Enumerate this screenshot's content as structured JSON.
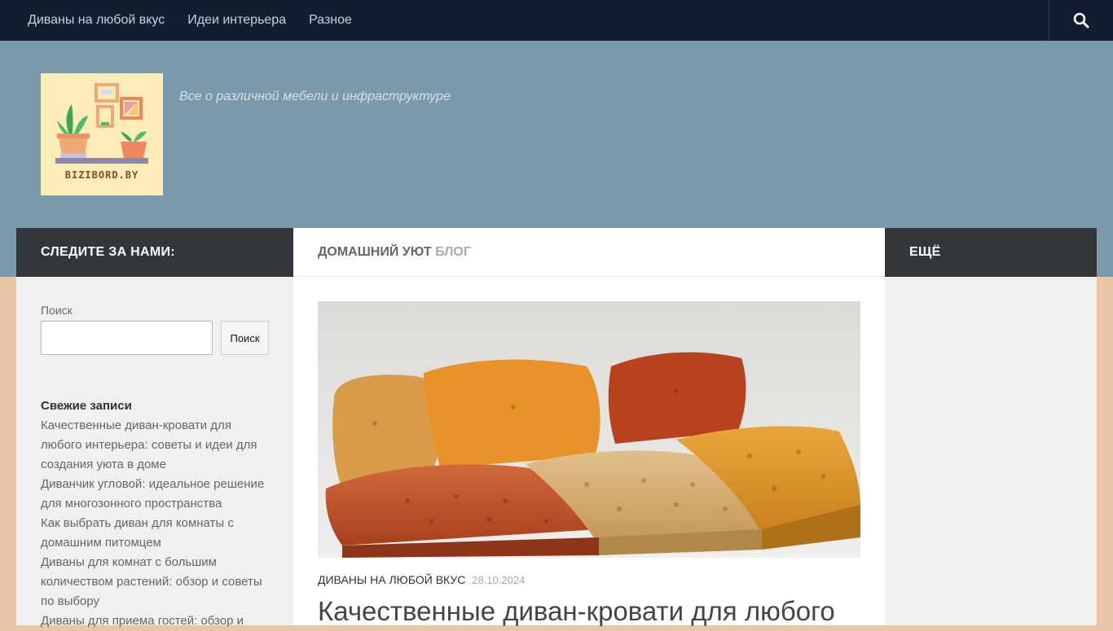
{
  "nav": {
    "items": [
      "Диваны на любой вкус",
      "Идеи интерьера",
      "Разное"
    ],
    "search_icon": "search-icon"
  },
  "header": {
    "logo_text": "BIZIBORD.BY",
    "tagline": "Все о различной мебели и инфраструктуре"
  },
  "left": {
    "heading": "СЛЕДИТЕ ЗА НАМИ:",
    "search_label": "Поиск",
    "search_button": "Поиск",
    "search_value": "",
    "recent_title": "Свежие записи",
    "recent_posts": [
      "Качественные диван-кровати для любого интерьера: советы и идеи для создания уюта в доме",
      "Диванчик угловой: идеальное решение для многозонного пространства",
      "Как выбрать диван для комнаты с домашним питомцем",
      "Диваны для комнат с большим количеством растений: обзор и советы по выбору",
      "Диваны для приема гостей: обзор и"
    ]
  },
  "main": {
    "heading_a": "ДОМАШНИЙ УЮТ",
    "heading_b": "БЛОГ",
    "post": {
      "category": "ДИВАНЫ НА ЛЮБОЙ ВКУС",
      "date": "28.10.2024",
      "title": "Качественные диван-кровати для любого"
    }
  },
  "right": {
    "heading": "ЕЩЁ"
  },
  "colors": {
    "topnav": "#131d30",
    "header": "#7a9aab",
    "page_bg": "#eac5a6",
    "dark_head": "#33363b"
  }
}
